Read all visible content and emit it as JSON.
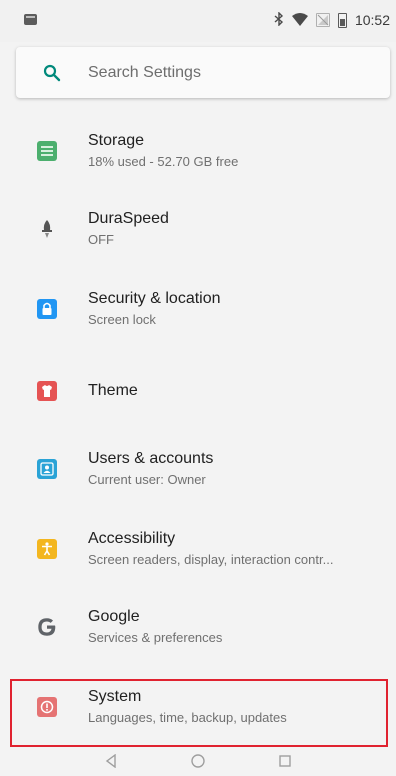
{
  "status_bar": {
    "time": "10:52",
    "icons": [
      "notification-icon",
      "bluetooth-icon",
      "wifi-icon",
      "no-signal-icon",
      "battery-icon"
    ]
  },
  "search": {
    "label": "Search Settings",
    "accent_color": "#00897b"
  },
  "items": [
    {
      "title": "Storage",
      "subtitle": "18% used - 52.70 GB free",
      "icon": "storage-icon",
      "color": "#4caf6e"
    },
    {
      "title": "DuraSpeed",
      "subtitle": "OFF",
      "icon": "rocket-icon",
      "color": "#555555"
    },
    {
      "title": "Security & location",
      "subtitle": "Screen lock",
      "icon": "lock-icon",
      "color": "#2196f3"
    },
    {
      "title": "Theme",
      "subtitle": "",
      "icon": "shirt-icon",
      "color": "#e55353"
    },
    {
      "title": "Users & accounts",
      "subtitle": "Current user: Owner",
      "icon": "user-icon",
      "color": "#2aa3d6"
    },
    {
      "title": "Accessibility",
      "subtitle": "Screen readers, display, interaction contr...",
      "icon": "accessibility-icon",
      "color": "#f3b61f"
    },
    {
      "title": "Google",
      "subtitle": "Services & preferences",
      "icon": "google-icon",
      "color": "#5f6368"
    },
    {
      "title": "System",
      "subtitle": "Languages, time, backup, updates",
      "icon": "info-icon",
      "color": "#e57373"
    }
  ],
  "navbar": {
    "icons": [
      "back-icon",
      "home-icon",
      "recents-icon"
    ]
  },
  "highlight_color": "#e0222f"
}
